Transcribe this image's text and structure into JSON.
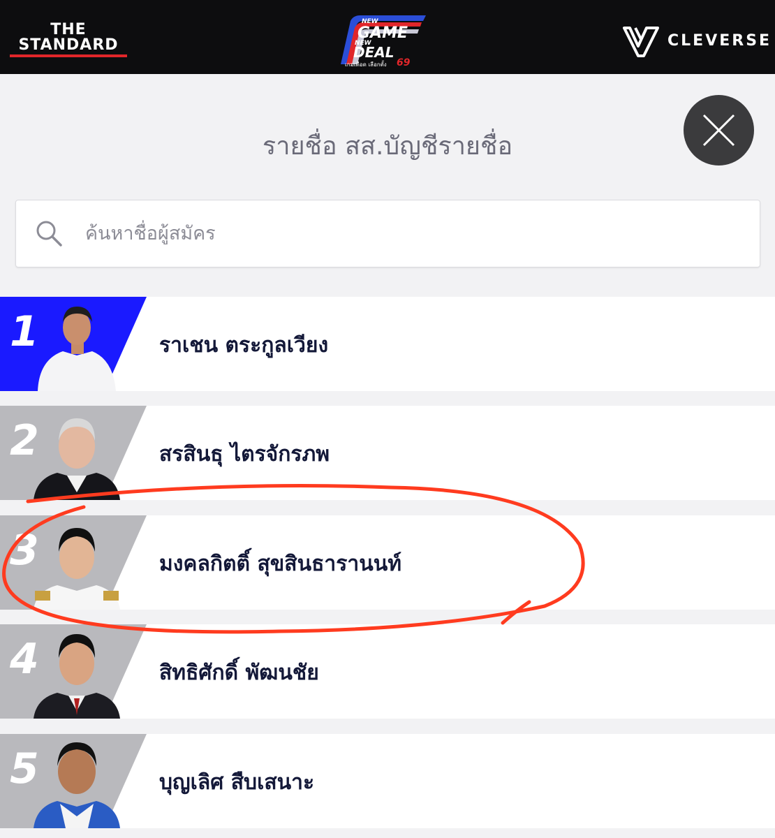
{
  "header": {
    "brand_left_line1": "THE",
    "brand_left_line2": "STANDARD",
    "campaign_logo": {
      "line1": "NEW",
      "line2": "GAME",
      "line3": "NEW",
      "line4": "DEAL",
      "number": "69",
      "tagline": "เกมเดือด เลือกตั้ง"
    },
    "brand_right": "CLEVERSE",
    "colors": {
      "background": "#0d0d0f",
      "accent_red": "#e0262a",
      "accent_blue": "#2b4ed8"
    }
  },
  "page": {
    "title": "รายชื่อ สส.บัญชีรายชื่อ",
    "close_icon": "close-icon"
  },
  "search": {
    "placeholder": "ค้นหาชื่อผู้สมัคร",
    "value": "",
    "icon": "search-icon"
  },
  "candidates": [
    {
      "rank": "1",
      "name": "ราเชน ตระกูลเวียง",
      "highlight": "blue"
    },
    {
      "rank": "2",
      "name": "สรสินธุ ไตรจักรภพ"
    },
    {
      "rank": "3",
      "name": "มงคลกิตติ์ สุขสินธารานนท์",
      "annotated": true
    },
    {
      "rank": "4",
      "name": "สิทธิศักดิ์ พัฒนชัย"
    },
    {
      "rank": "5",
      "name": "บุญเลิศ สืบเสนาะ"
    }
  ],
  "colors": {
    "first_badge": "#1a1aff",
    "other_badge": "#b9b9bd",
    "name_text": "#131838",
    "annotation_stroke": "#ff3b1f"
  }
}
